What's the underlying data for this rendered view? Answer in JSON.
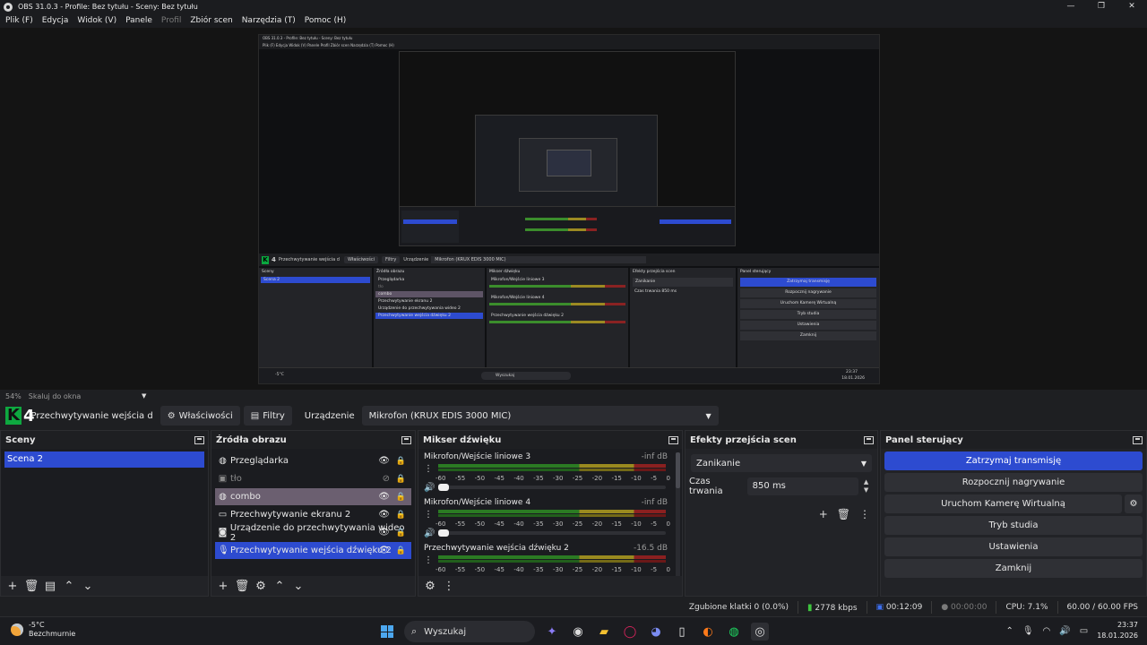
{
  "window": {
    "title": "OBS 31.0.3 - Profile: Bez tytułu - Sceny: Bez tytułu",
    "min": "—",
    "max": "❐",
    "close": "✕"
  },
  "menu": [
    "Plik (F)",
    "Edycja",
    "Widok (V)",
    "Panele",
    "Profil",
    "Zbiór scen",
    "Narzędzia (T)",
    "Pomoc (H)"
  ],
  "nested": {
    "title": "OBS 31.0.3 - Profile: Bez tytułu - Sceny: Bez tytułu",
    "menu": "Plik (F)   Edycja   Widok (V)   Panele   Profil   Zbiór scen   Narzędzia (T)   Pomoc (H)",
    "scale": "54%   Skaluj do okna",
    "toolbar": {
      "k": "K",
      "num": "4",
      "source": "Przechwytywanie wejścia d",
      "props": "Właściwości",
      "filters": "Filtry",
      "device_label": "Urządzenie",
      "device": "Mikrofon (KRUX EDIS 3000 MIC)"
    },
    "scenes_head": "Sceny",
    "scenes": [
      "Scena 2"
    ],
    "sources_head": "Źródła obrazu",
    "sources": [
      "Przeglądarka",
      "tło",
      "combo",
      "Przechwytywanie ekranu 2",
      "Urządzenie do przechwytywania wideo 2",
      "Przechwytywanie wejścia dźwięku 2"
    ],
    "mixer_head": "Mikser dźwięku",
    "mixer": [
      "Mikrofon/Wejście liniowe 3",
      "Mikrofon/Wejście liniowe 4",
      "Przechwytywanie wejścia dźwięku 2"
    ],
    "trans_head": "Efekty przejścia scen",
    "trans": "Zanikanie",
    "trans_dur": "Czas trwania   850 ms",
    "ctrl_head": "Panel sterujący",
    "ctrl": [
      "Zatrzymaj transmisję",
      "Rozpocznij nagrywanie",
      "Uruchom Kamerę Wirtualną",
      "Tryb studia",
      "Ustawienia",
      "Zamknij"
    ],
    "weather": "-5°C",
    "search": "Wyszukaj",
    "status": "Zgubione klatki 0 (0,0%)   2778 kbps   00:12:09   00:00:00   CPU: 7.1%   60.00 / 60.00 FPS",
    "time": "23:37",
    "date": "18.01.2026"
  },
  "scale": {
    "zoom": "54%",
    "label": "Skaluj do okna",
    "arrow": "▼"
  },
  "context": {
    "logo_letter": "K",
    "logo_num": "4",
    "source_name": "Przechwytywanie wejścia d",
    "props_label": "Właściwości",
    "props_icon": "gear-icon",
    "filters_label": "Filtry",
    "filters_icon": "filter-icon",
    "device_label": "Urządzenie",
    "device_value": "Mikrofon (KRUX EDIS 3000 MIC)"
  },
  "scenes": {
    "title": "Sceny",
    "items": [
      "Scena 2"
    ]
  },
  "sources": {
    "title": "Źródła obrazu",
    "items": [
      {
        "name": "Przeglądarka",
        "icon": "globe-icon",
        "state": "normal",
        "visible": true
      },
      {
        "name": "tło",
        "icon": "image-icon",
        "state": "hidden",
        "visible": false
      },
      {
        "name": "combo",
        "icon": "globe-icon",
        "state": "hover",
        "visible": true
      },
      {
        "name": "Przechwytywanie ekranu 2",
        "icon": "monitor-icon",
        "state": "normal",
        "visible": true
      },
      {
        "name": "Urządzenie do przechwytywania wideo 2",
        "icon": "camera-icon",
        "state": "normal",
        "visible": true
      },
      {
        "name": "Przechwytywanie wejścia dźwięku 2",
        "icon": "microphone-icon",
        "state": "selected",
        "visible": true
      }
    ]
  },
  "mixer": {
    "title": "Mikser dźwięku",
    "scale": [
      "-60",
      "-55",
      "-50",
      "-45",
      "-40",
      "-35",
      "-30",
      "-25",
      "-20",
      "-15",
      "-10",
      "-5",
      "0"
    ],
    "channels": [
      {
        "name": "Mikrofon/Wejście liniowe 3",
        "db": "-inf dB"
      },
      {
        "name": "Mikrofon/Wejście liniowe 4",
        "db": "-inf dB"
      },
      {
        "name": "Przechwytywanie wejścia dźwięku 2",
        "db": "-16.5 dB"
      }
    ]
  },
  "transitions": {
    "title": "Efekty przejścia scen",
    "selected": "Zanikanie",
    "duration_label": "Czas trwania",
    "duration_value": "850 ms"
  },
  "controls": {
    "title": "Panel sterujący",
    "stop_stream": "Zatrzymaj transmisję",
    "start_record": "Rozpocznij nagrywanie",
    "virtual_cam": "Uruchom Kamerę Wirtualną",
    "studio_mode": "Tryb studia",
    "settings": "Ustawienia",
    "exit": "Zamknij"
  },
  "status": {
    "dropped": "Zgubione klatki 0 (0.0%)",
    "bitrate": "2778 kbps",
    "stream_time": "00:12:09",
    "rec_time": "00:00:00",
    "cpu": "CPU: 7.1%",
    "fps": "60.00 / 60.00 FPS"
  },
  "taskbar": {
    "temp": "-5°C",
    "weather": "Bezchmurnie",
    "search_placeholder": "Wyszukaj",
    "time": "23:37",
    "date": "18.01.2026",
    "colors": {
      "accent": "#2d4bd0",
      "obs_green": "#0ea840"
    }
  }
}
